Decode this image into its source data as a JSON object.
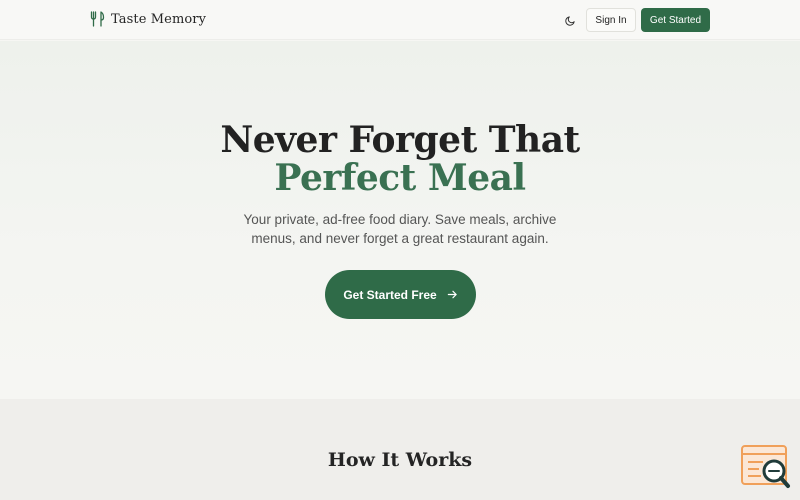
{
  "header": {
    "brand": "Taste Memory",
    "brand_icon": "utensils-icon",
    "theme_icon": "moon-icon",
    "signin_label": "Sign In",
    "getstarted_label": "Get Started"
  },
  "hero": {
    "title_line1": "Never Forget That",
    "title_line2": "Perfect Meal",
    "subtitle": "Your private, ad-free food diary. Save meals, archive menus, and never forget a great restaurant again.",
    "cta_label": "Get Started Free",
    "cta_icon": "arrow-right-icon"
  },
  "section": {
    "title": "How It Works"
  },
  "widget": {
    "icon": "help-search-icon"
  },
  "colors": {
    "primary": "#2f6b48",
    "accent_text": "#3a7152",
    "widget": "#f0a05a"
  }
}
